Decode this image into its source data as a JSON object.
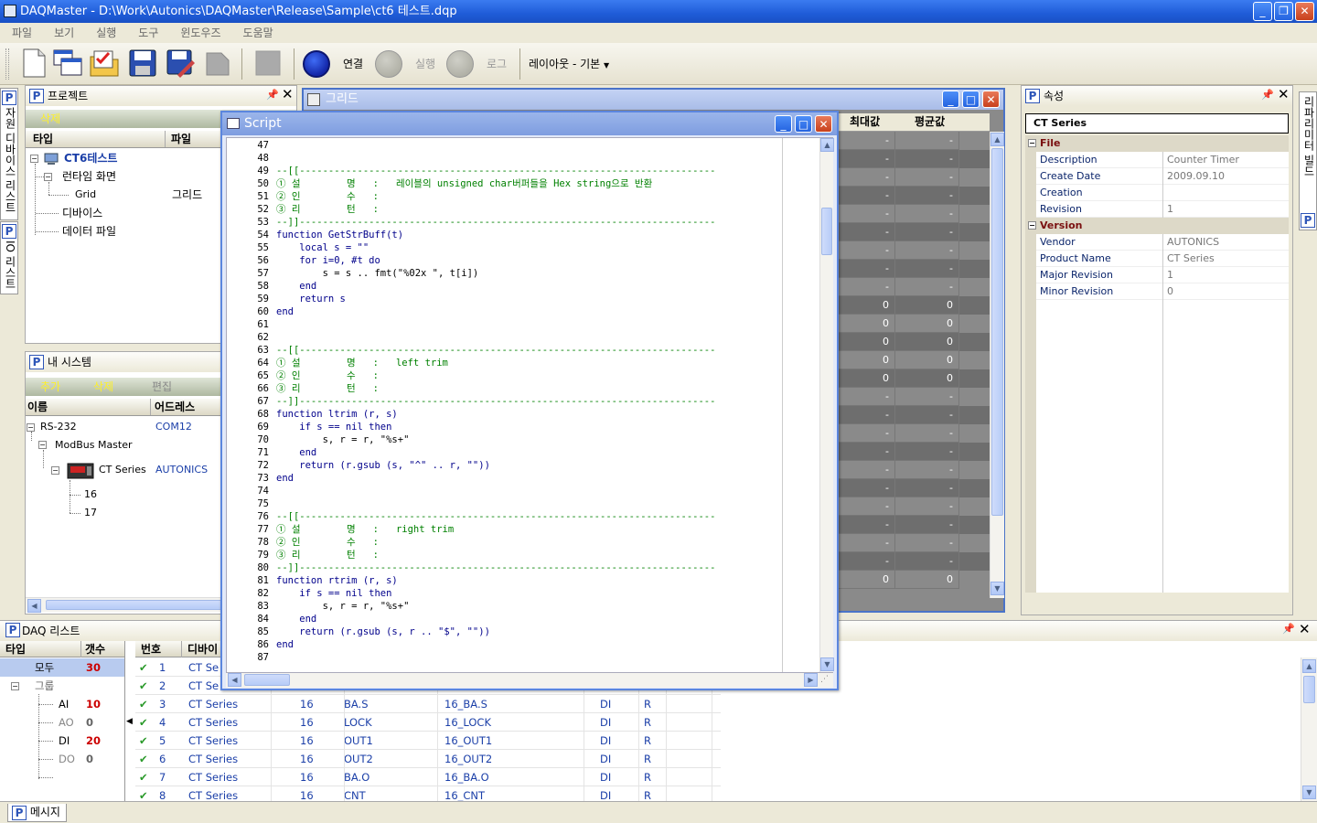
{
  "app": {
    "title": "DAQMaster - D:\\Work\\Autonics\\DAQMaster\\Release\\Sample\\ct6 테스트.dqp"
  },
  "menu": [
    "파일",
    "보기",
    "실행",
    "도구",
    "윈도우즈",
    "도움말"
  ],
  "toolbar": {
    "connect": "연결",
    "run": "실행",
    "log": "로그",
    "layout": "레이아웃 - 기본"
  },
  "sidetabs": {
    "left1": "자원 디바이스 리스트",
    "left2": "IO 리스트",
    "right": "리파리미터 빌드"
  },
  "project": {
    "title": "프로젝트",
    "delete": "삭제",
    "col_type": "타입",
    "col_file": "파일",
    "items": [
      {
        "label": "CT6테스트",
        "file": ""
      },
      {
        "label": "런타임 화면",
        "file": ""
      },
      {
        "label": "Grid",
        "file": "그리드"
      },
      {
        "label": "디바이스",
        "file": ""
      },
      {
        "label": "데이터 파일",
        "file": ""
      }
    ]
  },
  "mysystem": {
    "title": "내 시스템",
    "add": "추가",
    "delete": "삭제",
    "edit": "편집",
    "col_name": "이름",
    "col_addr": "어드레스",
    "items": [
      {
        "label": "RS-232",
        "addr": "COM12"
      },
      {
        "label": "ModBus Master",
        "addr": ""
      },
      {
        "label": "CT Series",
        "addr": "AUTONICS"
      },
      {
        "label": "16",
        "addr": ""
      },
      {
        "label": "17",
        "addr": ""
      }
    ]
  },
  "grid": {
    "title": "그리드",
    "col_max": "최대값",
    "col_avg": "평균값",
    "rows": [
      [
        "-",
        "-"
      ],
      [
        "-",
        "-"
      ],
      [
        "-",
        "-"
      ],
      [
        "-",
        "-"
      ],
      [
        "-",
        "-"
      ],
      [
        "-",
        "-"
      ],
      [
        "-",
        "-"
      ],
      [
        "-",
        "-"
      ],
      [
        "-",
        "-"
      ],
      [
        "0",
        "0"
      ],
      [
        "0",
        "0"
      ],
      [
        "0",
        "0"
      ],
      [
        "0",
        "0"
      ],
      [
        "0",
        "0"
      ],
      [
        "-",
        "-"
      ],
      [
        "-",
        "-"
      ],
      [
        "-",
        "-"
      ],
      [
        "-",
        "-"
      ],
      [
        "-",
        "-"
      ],
      [
        "-",
        "-"
      ],
      [
        "-",
        "-"
      ],
      [
        "-",
        "-"
      ],
      [
        "-",
        "-"
      ],
      [
        "-",
        "-"
      ],
      [
        "0",
        "0"
      ]
    ]
  },
  "script": {
    "title": "Script",
    "lines": [
      {
        "n": "47",
        "t": ""
      },
      {
        "n": "48",
        "t": ""
      },
      {
        "n": "49",
        "t": "--[[------------------------------------------------------------------------",
        "c": "cm"
      },
      {
        "n": "50",
        "t": "① 설        명   :   레이블의 unsigned char버퍼들을 Hex string으로 반환",
        "c": "cm"
      },
      {
        "n": "51",
        "t": "② 인        수   :",
        "c": "cm"
      },
      {
        "n": "52",
        "t": "③ 리        턴   :",
        "c": "cm"
      },
      {
        "n": "53",
        "t": "--]]------------------------------------------------------------------------",
        "c": "cm"
      },
      {
        "n": "54",
        "t": "function GetStrBuff(t)",
        "c": "kw"
      },
      {
        "n": "55",
        "t": "    local s = \"\"",
        "c": "kw"
      },
      {
        "n": "56",
        "t": "    for i=0, #t do",
        "c": "kw"
      },
      {
        "n": "57",
        "t": "        s = s .. fmt(\"%02x \", t[i])"
      },
      {
        "n": "58",
        "t": "    end",
        "c": "kw"
      },
      {
        "n": "59",
        "t": "    return s",
        "c": "kw"
      },
      {
        "n": "60",
        "t": "end",
        "c": "kw"
      },
      {
        "n": "61",
        "t": ""
      },
      {
        "n": "62",
        "t": ""
      },
      {
        "n": "63",
        "t": "--[[------------------------------------------------------------------------",
        "c": "cm"
      },
      {
        "n": "64",
        "t": "① 설        명   :   left trim",
        "c": "cm"
      },
      {
        "n": "65",
        "t": "② 인        수   :",
        "c": "cm"
      },
      {
        "n": "66",
        "t": "③ 리        턴   :",
        "c": "cm"
      },
      {
        "n": "67",
        "t": "--]]------------------------------------------------------------------------",
        "c": "cm"
      },
      {
        "n": "68",
        "t": "function ltrim (r, s)",
        "c": "kw"
      },
      {
        "n": "69",
        "t": "    if s == nil then",
        "c": "kw"
      },
      {
        "n": "70",
        "t": "        s, r = r, \"%s+\""
      },
      {
        "n": "71",
        "t": "    end",
        "c": "kw"
      },
      {
        "n": "72",
        "t": "    return (r.gsub (s, \"^\" .. r, \"\"))",
        "c": "kw"
      },
      {
        "n": "73",
        "t": "end",
        "c": "kw"
      },
      {
        "n": "74",
        "t": ""
      },
      {
        "n": "75",
        "t": ""
      },
      {
        "n": "76",
        "t": "--[[------------------------------------------------------------------------",
        "c": "cm"
      },
      {
        "n": "77",
        "t": "① 설        명   :   right trim",
        "c": "cm"
      },
      {
        "n": "78",
        "t": "② 인        수   :",
        "c": "cm"
      },
      {
        "n": "79",
        "t": "③ 리        턴   :",
        "c": "cm"
      },
      {
        "n": "80",
        "t": "--]]------------------------------------------------------------------------",
        "c": "cm"
      },
      {
        "n": "81",
        "t": "function rtrim (r, s)",
        "c": "kw"
      },
      {
        "n": "82",
        "t": "    if s == nil then",
        "c": "kw"
      },
      {
        "n": "83",
        "t": "        s, r = r, \"%s+\""
      },
      {
        "n": "84",
        "t": "    end",
        "c": "kw"
      },
      {
        "n": "85",
        "t": "    return (r.gsub (s, r .. \"$\", \"\"))",
        "c": "kw"
      },
      {
        "n": "86",
        "t": "end",
        "c": "kw"
      },
      {
        "n": "87",
        "t": ""
      }
    ]
  },
  "props": {
    "title": "속성",
    "object": "CT Series",
    "sections": [
      {
        "name": "File",
        "rows": [
          [
            "Description",
            "Counter Timer"
          ],
          [
            "Create Date",
            "2009.09.10"
          ],
          [
            "Creation",
            ""
          ],
          [
            "Revision",
            "1"
          ]
        ]
      },
      {
        "name": "Version",
        "rows": [
          [
            "Vendor",
            "AUTONICS"
          ],
          [
            "Product Name",
            "CT Series"
          ],
          [
            "Major Revision",
            "1"
          ],
          [
            "Minor Revision",
            "0"
          ]
        ]
      }
    ]
  },
  "daq": {
    "title": "DAQ 리스트",
    "col_type": "타입",
    "col_count": "갯수",
    "col_no": "번호",
    "col_device": "디바이",
    "groups": [
      {
        "label": "모두",
        "count": "30"
      },
      {
        "label": "그룹",
        "count": ""
      },
      {
        "label": "AI",
        "count": "10"
      },
      {
        "label": "AO",
        "count": "0"
      },
      {
        "label": "DI",
        "count": "20"
      },
      {
        "label": "DO",
        "count": "0"
      }
    ],
    "rows": [
      [
        "1",
        "CT Se",
        "",
        "",
        "",
        "",
        ""
      ],
      [
        "2",
        "CT Se",
        "",
        "",
        "",
        "",
        ""
      ],
      [
        "3",
        "CT Series",
        "16",
        "BA.S",
        "16_BA.S",
        "DI",
        "R"
      ],
      [
        "4",
        "CT Series",
        "16",
        "LOCK",
        "16_LOCK",
        "DI",
        "R"
      ],
      [
        "5",
        "CT Series",
        "16",
        "OUT1",
        "16_OUT1",
        "DI",
        "R"
      ],
      [
        "6",
        "CT Series",
        "16",
        "OUT2",
        "16_OUT2",
        "DI",
        "R"
      ],
      [
        "7",
        "CT Series",
        "16",
        "BA.O",
        "16_BA.O",
        "DI",
        "R"
      ],
      [
        "8",
        "CT Series",
        "16",
        "CNT",
        "16_CNT",
        "DI",
        "R"
      ]
    ]
  },
  "status": {
    "message_tab": "메시지"
  }
}
